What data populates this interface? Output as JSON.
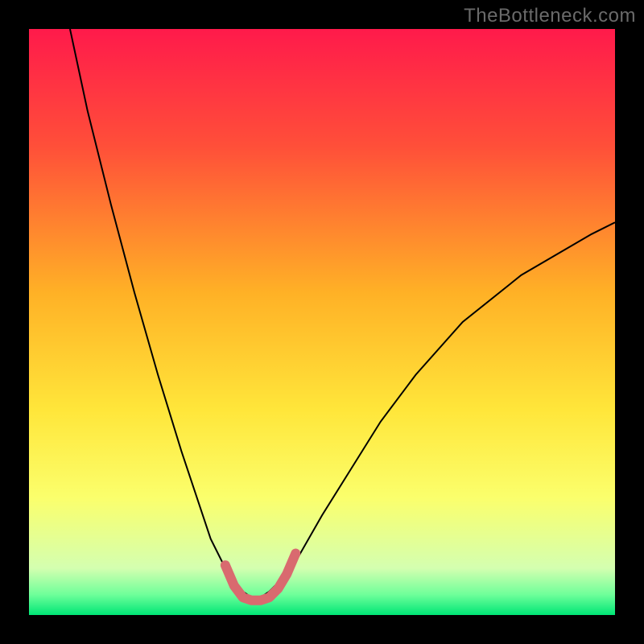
{
  "watermark": "TheBottleneck.com",
  "chart_data": {
    "type": "line",
    "title": "",
    "xlabel": "",
    "ylabel": "",
    "xlim": [
      0,
      100
    ],
    "ylim": [
      0,
      100
    ],
    "background_gradient": {
      "stops": [
        {
          "offset": 0.0,
          "color": "#ff1a4b"
        },
        {
          "offset": 0.2,
          "color": "#ff4f39"
        },
        {
          "offset": 0.45,
          "color": "#ffb126"
        },
        {
          "offset": 0.65,
          "color": "#ffe63a"
        },
        {
          "offset": 0.8,
          "color": "#fbff6c"
        },
        {
          "offset": 0.92,
          "color": "#d4ffb0"
        },
        {
          "offset": 0.965,
          "color": "#6fff9a"
        },
        {
          "offset": 1.0,
          "color": "#00e676"
        }
      ]
    },
    "series": [
      {
        "name": "bottleneck-curve",
        "stroke": "#000000",
        "stroke_width": 2,
        "x": [
          7,
          10,
          14,
          18,
          22,
          26,
          29,
          31,
          33,
          35,
          36.5,
          38,
          39.5,
          41,
          43,
          46,
          50,
          55,
          60,
          66,
          74,
          84,
          96,
          100
        ],
        "y": [
          100,
          86,
          70,
          55,
          41,
          28,
          19,
          13,
          9,
          6,
          4,
          3,
          3,
          4,
          6,
          10,
          17,
          25,
          33,
          41,
          50,
          58,
          65,
          67
        ]
      },
      {
        "name": "sweet-spot-marker",
        "stroke": "#d96a6f",
        "stroke_width": 12,
        "linecap": "round",
        "x": [
          33.5,
          35,
          36.5,
          38,
          39.5,
          41,
          42.5,
          44,
          45.5
        ],
        "y": [
          8.5,
          5,
          3,
          2.5,
          2.5,
          3,
          4.5,
          7,
          10.5
        ]
      }
    ]
  }
}
